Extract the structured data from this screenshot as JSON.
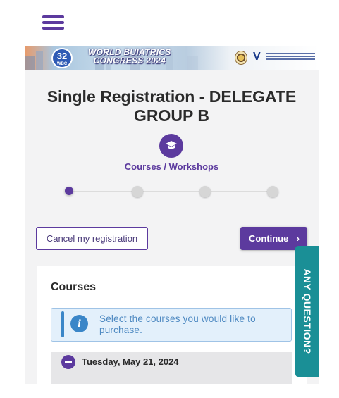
{
  "header": {
    "menu_icon": "hamburger-menu-icon",
    "brand_color": "#5c3a9e"
  },
  "banner": {
    "logo_number": "32",
    "logo_abbr": "WBC",
    "title_line1": "WORLD BUIATRICS",
    "title_line2": "CONGRESS 2024"
  },
  "page": {
    "title": "Single Registration - DELEGATE GROUP B"
  },
  "stepper": {
    "current_step_label": "Courses / Workshops",
    "current_step_icon": "graduation-cap-icon",
    "total_steps": 4,
    "active_step": 1
  },
  "actions": {
    "cancel_label": "Cancel my registration",
    "continue_label": "Continue",
    "continue_icon": "chevron-right-icon"
  },
  "courses": {
    "title": "Courses",
    "info_text": "Select the courses you would like to purchase.",
    "info_icon": "info-icon",
    "info_color": "#3a86c8",
    "date_group": "Tuesday, May 21, 2024",
    "collapse_icon": "minus-circle-icon"
  },
  "help_tab": {
    "label": "ANY QUESTION?",
    "color": "#1a8f96"
  }
}
